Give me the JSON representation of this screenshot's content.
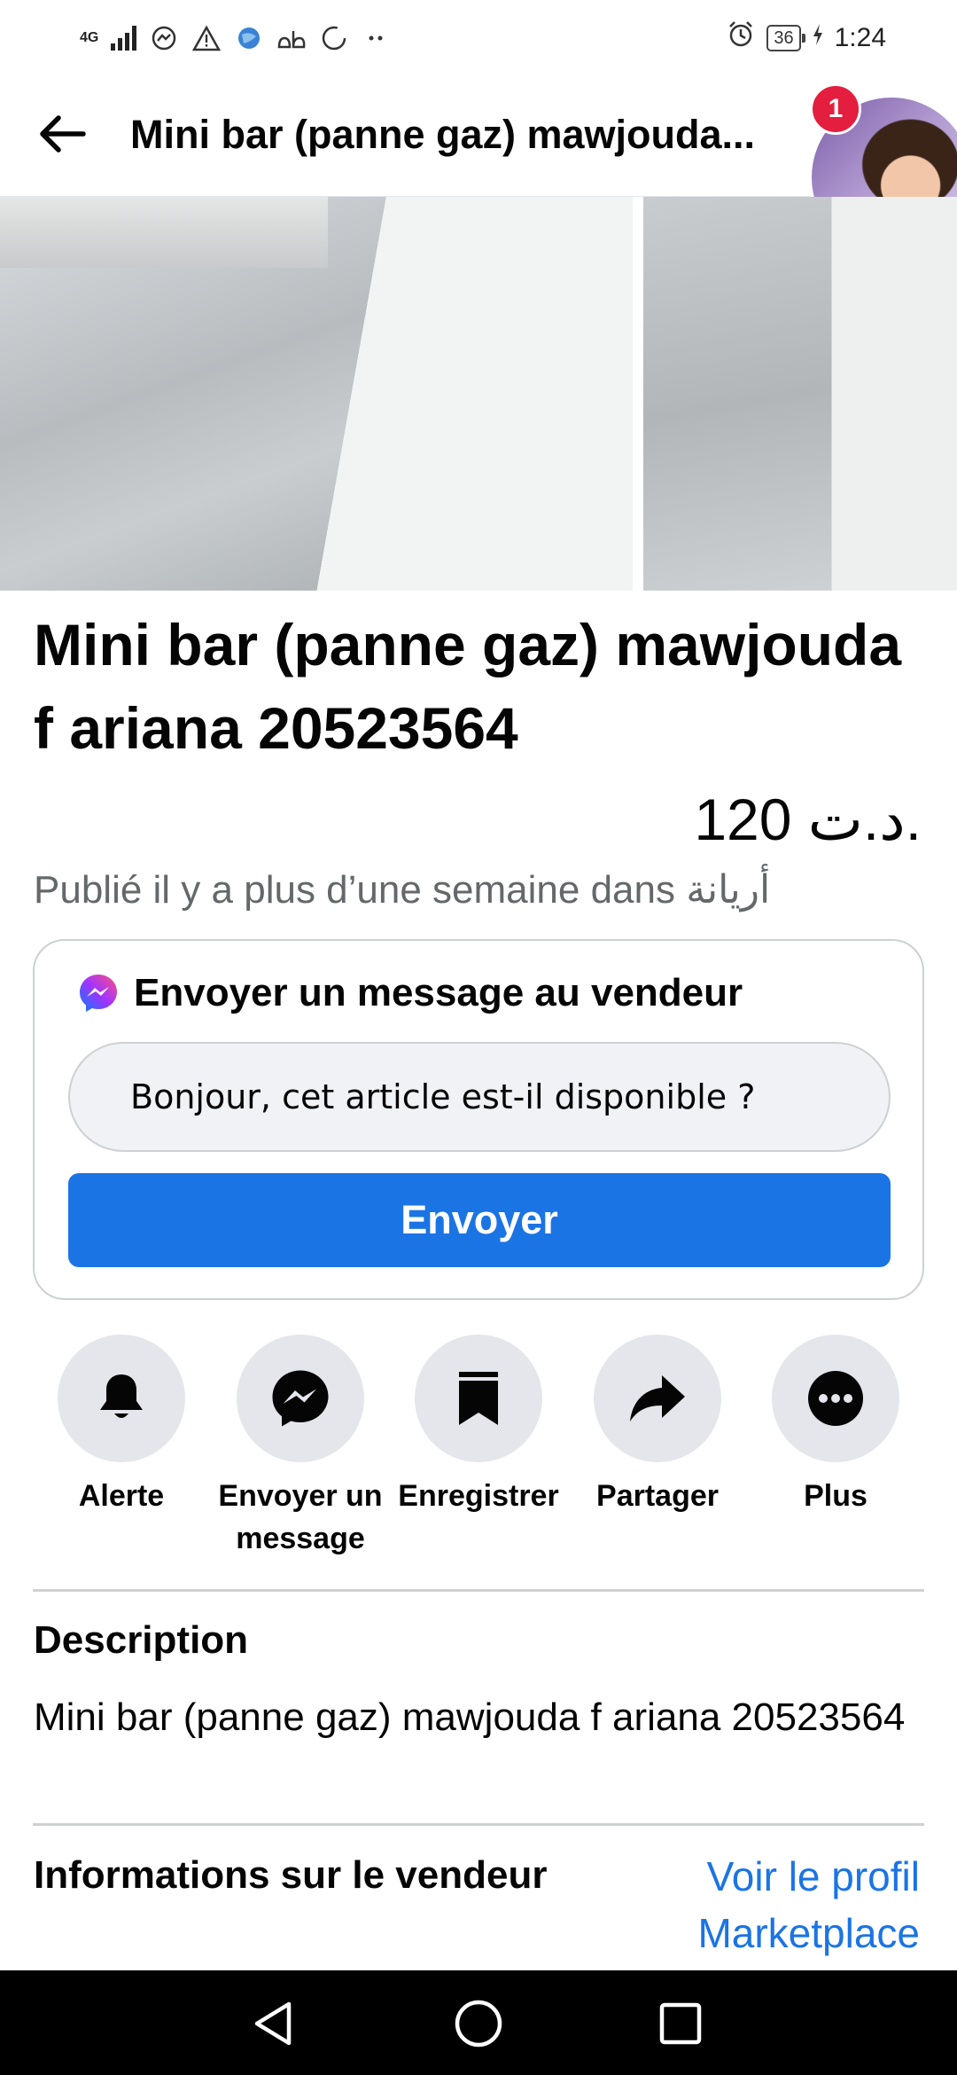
{
  "status_bar": {
    "network": "4G",
    "battery": "36",
    "time": "1:24"
  },
  "header": {
    "title": "Mini bar (panne gaz) mawjouda...",
    "notification_count": "1"
  },
  "listing": {
    "title": "Mini bar (panne gaz) mawjouda f ariana 20523564",
    "price": "120 د.ت.",
    "posted": "Publié il y a plus d’une semaine dans أريانة"
  },
  "message_card": {
    "heading": "Envoyer un message au vendeur",
    "input_value": "Bonjour, cet article est-il disponible ?",
    "send_label": "Envoyer"
  },
  "actions": [
    {
      "label": "Alerte",
      "icon": "bell-icon"
    },
    {
      "label": "Envoyer un message",
      "icon": "messenger-icon"
    },
    {
      "label": "Enregistrer",
      "icon": "bookmark-icon"
    },
    {
      "label": "Partager",
      "icon": "share-arrow-icon"
    },
    {
      "label": "Plus",
      "icon": "more-dots-icon"
    }
  ],
  "description": {
    "heading": "Description",
    "text": "Mini bar (panne gaz) mawjouda f ariana 20523564"
  },
  "seller": {
    "heading": "Informations sur le vendeur",
    "profile_link": "Voir le profil Marketplace"
  },
  "colors": {
    "accent": "#1b74e4",
    "badge": "#e41e3f",
    "muted_text": "#65676b",
    "action_circle": "#e4e6eb"
  }
}
